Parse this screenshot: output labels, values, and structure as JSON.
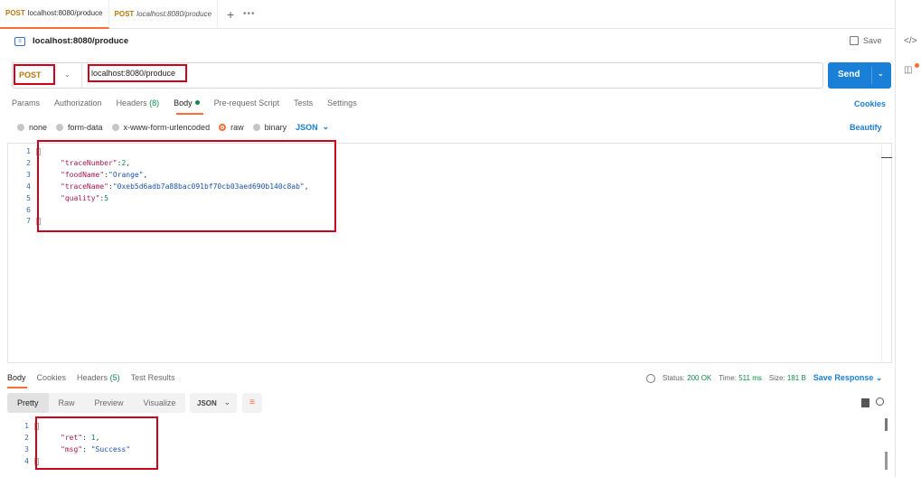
{
  "tabs": [
    {
      "method": "POST",
      "url": "localhost:8080/produce"
    },
    {
      "method": "POST",
      "url": "localhost:8080/produce"
    }
  ],
  "tab_add": "+",
  "tab_more": "•••",
  "request": {
    "title": "localhost:8080/produce",
    "save_label": "Save",
    "method": "POST",
    "url": "localhost:8080/produce",
    "send_label": "Send"
  },
  "request_tabs": {
    "params": "Params",
    "authorization": "Authorization",
    "headers": "Headers",
    "headers_count": "(8)",
    "body": "Body",
    "pre_request": "Pre-request Script",
    "tests": "Tests",
    "settings": "Settings",
    "cookies": "Cookies"
  },
  "body_types": {
    "none": "none",
    "form_data": "form-data",
    "urlencoded": "x-www-form-urlencoded",
    "raw": "raw",
    "binary": "binary",
    "language": "JSON",
    "beautify": "Beautify"
  },
  "request_body_lines": [
    {
      "num": "1",
      "parts": []
    },
    {
      "num": "2",
      "parts": [
        {
          "t": "\"traceNumber\"",
          "c": "k"
        },
        {
          "t": ":",
          "c": "p"
        },
        {
          "t": "2",
          "c": "n"
        },
        {
          "t": ",",
          "c": "p"
        }
      ]
    },
    {
      "num": "3",
      "parts": [
        {
          "t": "\"foodName\"",
          "c": "k"
        },
        {
          "t": ":",
          "c": "p"
        },
        {
          "t": "\"Orange\"",
          "c": "s"
        },
        {
          "t": ",",
          "c": "p"
        }
      ]
    },
    {
      "num": "4",
      "parts": [
        {
          "t": "\"traceName\"",
          "c": "k"
        },
        {
          "t": ":",
          "c": "p"
        },
        {
          "t": "\"0xeb5d6adb7a88bac091bf70cb03aed690b140c8ab\"",
          "c": "s"
        },
        {
          "t": ",",
          "c": "p"
        }
      ]
    },
    {
      "num": "5",
      "parts": [
        {
          "t": "\"quality\"",
          "c": "k"
        },
        {
          "t": ":",
          "c": "p"
        },
        {
          "t": "5",
          "c": "n"
        }
      ]
    },
    {
      "num": "6",
      "parts": []
    },
    {
      "num": "7",
      "parts": []
    }
  ],
  "response_tabs": {
    "body": "Body",
    "cookies": "Cookies",
    "headers": "Headers",
    "headers_count": "(5)",
    "test_results": "Test Results"
  },
  "response_meta": {
    "status_label": "Status:",
    "status_value": "200 OK",
    "time_label": "Time:",
    "time_value": "511 ms",
    "size_label": "Size:",
    "size_value": "181 B",
    "save_response": "Save Response"
  },
  "response_views": {
    "pretty": "Pretty",
    "raw": "Raw",
    "preview": "Preview",
    "visualize": "Visualize",
    "format": "JSON"
  },
  "response_body_lines": [
    {
      "num": "1",
      "parts": []
    },
    {
      "num": "2",
      "parts": [
        {
          "t": "\"ret\"",
          "c": "k"
        },
        {
          "t": ": ",
          "c": "p"
        },
        {
          "t": "1",
          "c": "n"
        },
        {
          "t": ",",
          "c": "p"
        }
      ]
    },
    {
      "num": "3",
      "parts": [
        {
          "t": "\"msg\"",
          "c": "k"
        },
        {
          "t": ": ",
          "c": "p"
        },
        {
          "t": "\"Success\"",
          "c": "s"
        }
      ]
    },
    {
      "num": "4",
      "parts": []
    }
  ],
  "colors": {
    "accent": "#ff6c37",
    "send": "#1a7fd6",
    "highlight_box": "#d0021b",
    "method": "#b8790e",
    "ok": "#0f8a4a"
  }
}
